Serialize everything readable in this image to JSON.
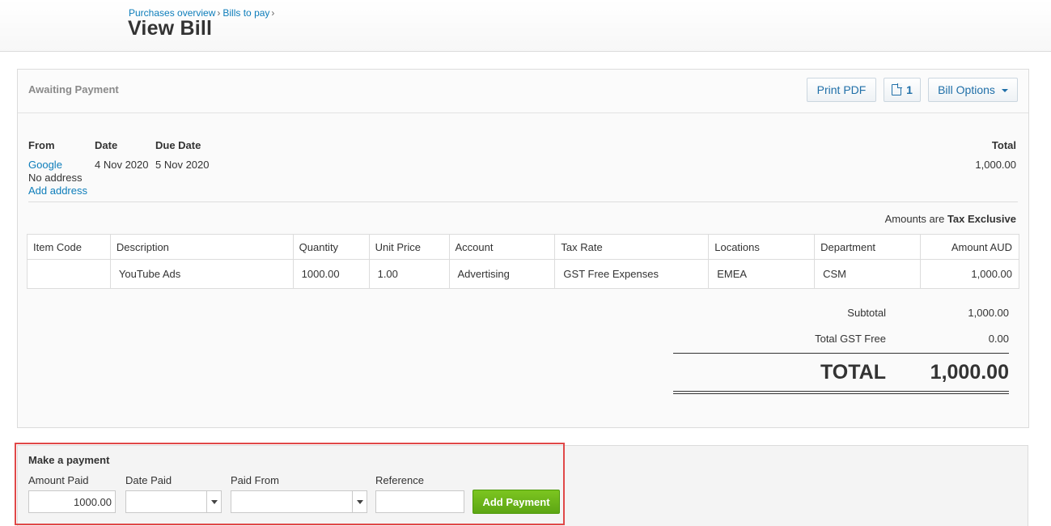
{
  "breadcrumb": [
    {
      "label": "Purchases overview"
    },
    {
      "label": "Bills to pay"
    }
  ],
  "breadcrumb_separator": "›",
  "page_title": "View Bill",
  "bill": {
    "status": "Awaiting Payment",
    "actions": {
      "print_label": "Print PDF",
      "files_count": "1",
      "files_icon": "document-icon",
      "options_label": "Bill Options"
    },
    "from_label": "From",
    "from_name": "Google",
    "no_address": "No address",
    "add_address": "Add address",
    "date_label": "Date",
    "date_value": "4 Nov 2020",
    "due_label": "Due Date",
    "due_value": "5 Nov 2020",
    "total_label": "Total",
    "total_value": "1,000.00",
    "amounts_are_label": "Amounts are",
    "amounts_are_value": "Tax Exclusive",
    "columns": [
      "Item Code",
      "Description",
      "Quantity",
      "Unit Price",
      "Account",
      "Tax Rate",
      "Locations",
      "Department",
      "Amount AUD"
    ],
    "rows": [
      {
        "item_code": "",
        "description": "YouTube Ads",
        "quantity": "1000.00",
        "unit_price": "1.00",
        "account": "Advertising",
        "tax_rate": "GST Free Expenses",
        "location": "EMEA",
        "department": "CSM",
        "amount": "1,000.00"
      }
    ],
    "subtotal_label": "Subtotal",
    "subtotal_value": "1,000.00",
    "tax_label": "Total GST Free",
    "tax_value": "0.00",
    "grand_label": "TOTAL",
    "grand_value": "1,000.00"
  },
  "payment": {
    "title": "Make a payment",
    "amount_label": "Amount Paid",
    "amount_value": "1000.00",
    "date_label": "Date Paid",
    "date_value": "",
    "from_label": "Paid From",
    "from_value": "",
    "reference_label": "Reference",
    "reference_value": "",
    "add_label": "Add Payment"
  },
  "colors": {
    "link": "#0d7dba",
    "accent_green": "#6bb81a",
    "highlight_red": "#e04848"
  }
}
